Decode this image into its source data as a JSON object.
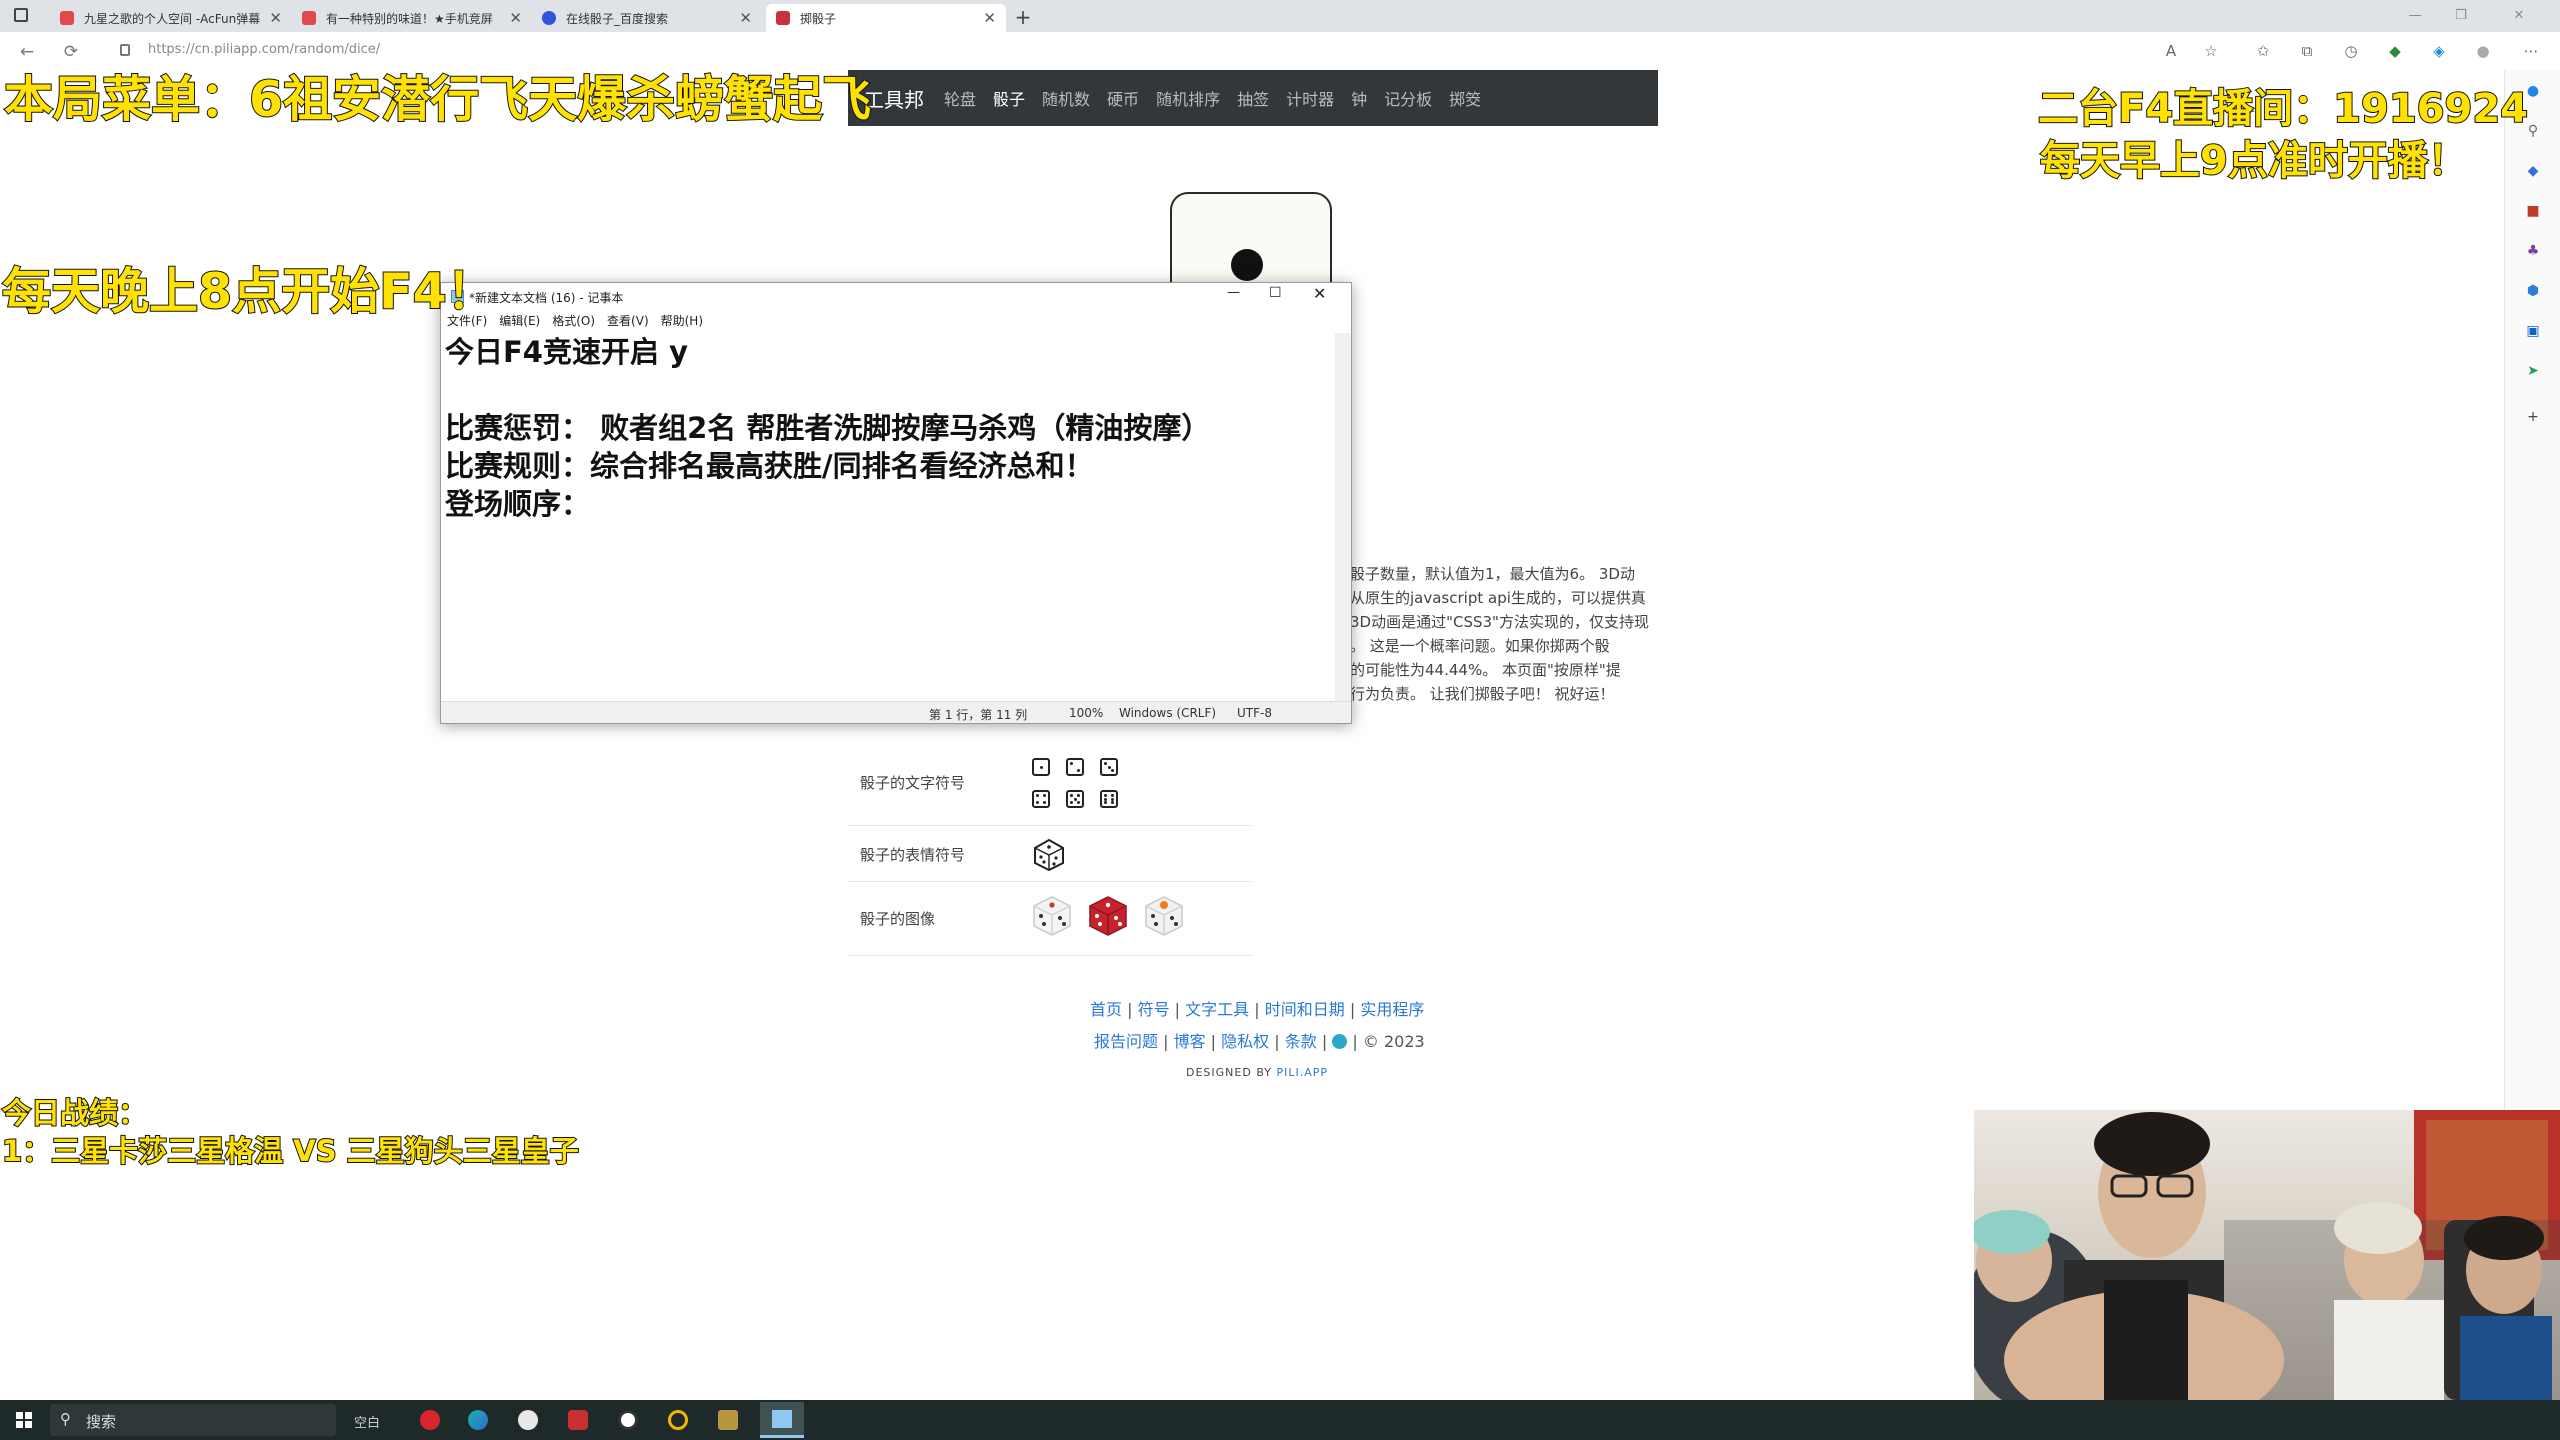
{
  "browser": {
    "tabs": [
      {
        "title": "九星之歌的个人空间 -AcFun弹幕",
        "color": "#e04a4a",
        "active": false
      },
      {
        "title": "有一种特别的味道！★手机竞屏",
        "color": "#e04a4a",
        "active": false
      },
      {
        "title": "在线骰子_百度搜索",
        "color": "#2f56d8",
        "active": false
      },
      {
        "title": "掷骰子",
        "color": "#c8323c",
        "active": true
      }
    ],
    "url": "https://cn.piliapp.com/random/dice/"
  },
  "site": {
    "brand": "工具邦",
    "nav": [
      "轮盘",
      "骰子",
      "随机数",
      "硬币",
      "随机排序",
      "抽签",
      "计时器",
      "钟",
      "记分板",
      "掷筊"
    ],
    "active_nav": "骰子",
    "description_lines": [
      "骰子数量，默认值为1，最大值为6。 3D动",
      "从原生的javascript api生成的，可以提供真",
      "3D动画是通过\"CSS3\"方法实现的，仅支持现",
      "。 这是一个概率问题。如果你掷两个骰",
      "的可能性为44.44%。 本页面\"按原样\"提",
      "行为负责。 让我们掷骰子吧！ 祝好运！"
    ],
    "table": [
      {
        "label": "骰子的文字符号"
      },
      {
        "label": "骰子的表情符号"
      },
      {
        "label": "骰子的图像"
      }
    ],
    "footer_row1": [
      "首页",
      "符号",
      "文字工具",
      "时间和日期",
      "实用程序"
    ],
    "footer_row2": [
      "报告问题",
      "博客",
      "隐私权",
      "条款"
    ],
    "copyright": "| © 2023",
    "credit_prefix": "DESIGNED BY ",
    "credit_brand": "PILI.APP"
  },
  "notepad": {
    "title": "*新建文本文档 (16) - 记事本",
    "menu": [
      "文件(F)",
      "编辑(E)",
      "格式(O)",
      "查看(V)",
      "帮助(H)"
    ],
    "lines": [
      "今日F4竞速开启 y",
      "",
      "比赛惩罚： 败者组2名 帮胜者洗脚按摩马杀鸡（精油按摩）",
      "比赛规则：综合排名最高获胜/同排名看经济总和！",
      "登场顺序："
    ],
    "status": {
      "position": "第 1 行，第 11 列",
      "zoom": "100%",
      "eol": "Windows (CRLF)",
      "encoding": "UTF-8"
    }
  },
  "overlays": {
    "menu": "本局菜单：6祖安潜行飞天爆杀螃蟹起飞",
    "room": "二台F4直播间：1916924",
    "morning": "每天早上9点准时开播！",
    "evening": "每天晚上8点开始F4！",
    "record_title": "今日战绩：",
    "record_1": "1：三星卡莎三星格温 VS 三星狗头三星皇子"
  },
  "taskbar": {
    "search": "搜索",
    "blank": "空白"
  }
}
